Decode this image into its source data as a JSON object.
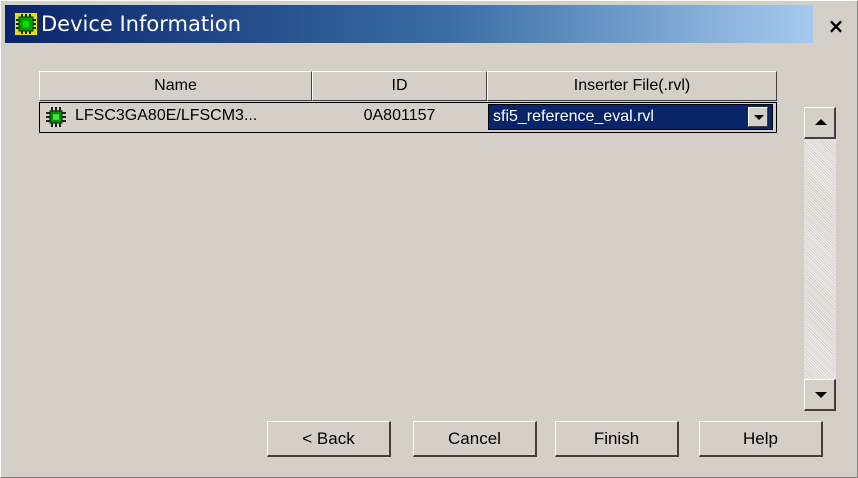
{
  "window": {
    "title": "Device Information",
    "close_label": "×",
    "title_gradient": [
      "#0a246a",
      "#a6caf0"
    ]
  },
  "table": {
    "headers": [
      "Name",
      "ID",
      "Inserter File(.rvl)"
    ],
    "rows": [
      {
        "icon": "chip-icon",
        "name": "LFSC3GA80E/LFSCM3...",
        "id": "0A801157",
        "inserter_file": "sfi5_reference_eval.rvl"
      }
    ]
  },
  "buttons": {
    "back": "< Back",
    "cancel": "Cancel",
    "finish": "Finish",
    "help": "Help"
  }
}
